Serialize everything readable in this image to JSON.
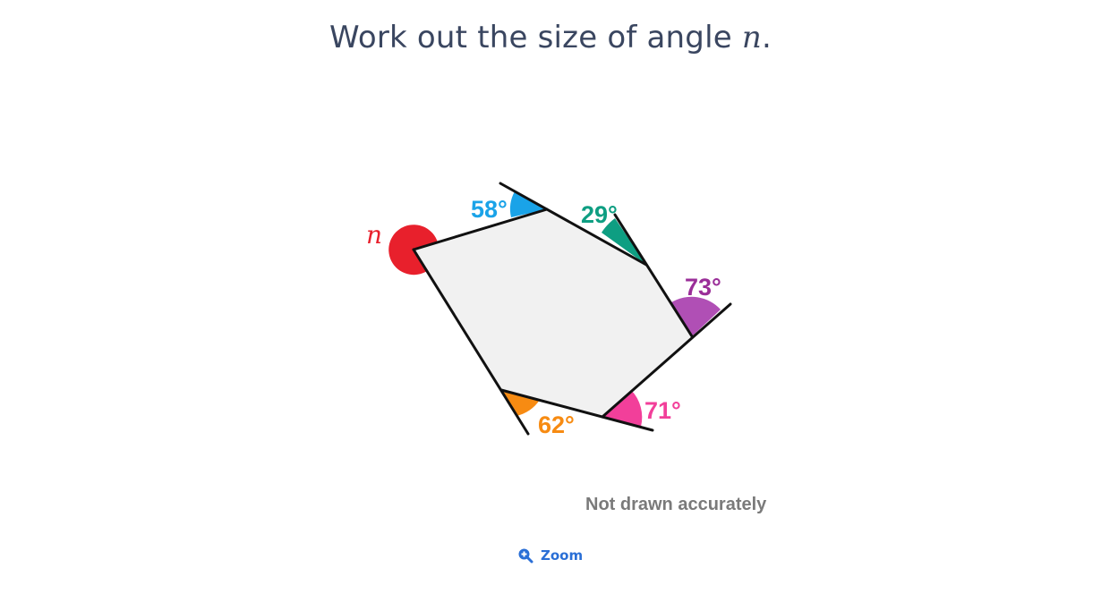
{
  "question": {
    "text": "Work out the size of angle ",
    "variable": "n",
    "suffix": "."
  },
  "diagram": {
    "unknown_angle_label": "n",
    "angles": [
      {
        "label": "58°",
        "color": "#1aa3e8"
      },
      {
        "label": "29°",
        "color": "#0e9e82"
      },
      {
        "label": "73°",
        "color": "#b04fb5"
      },
      {
        "label": "71°",
        "color": "#f23f9a"
      },
      {
        "label": "62°",
        "color": "#f78b12"
      }
    ],
    "unknown_color": "#e8202c",
    "polygon_fill": "#f1f1f1",
    "note": "Not drawn accurately"
  },
  "controls": {
    "zoom_label": "Zoom",
    "zoom_icon": "zoom-in-icon",
    "accent_color": "#2a6fd6"
  }
}
